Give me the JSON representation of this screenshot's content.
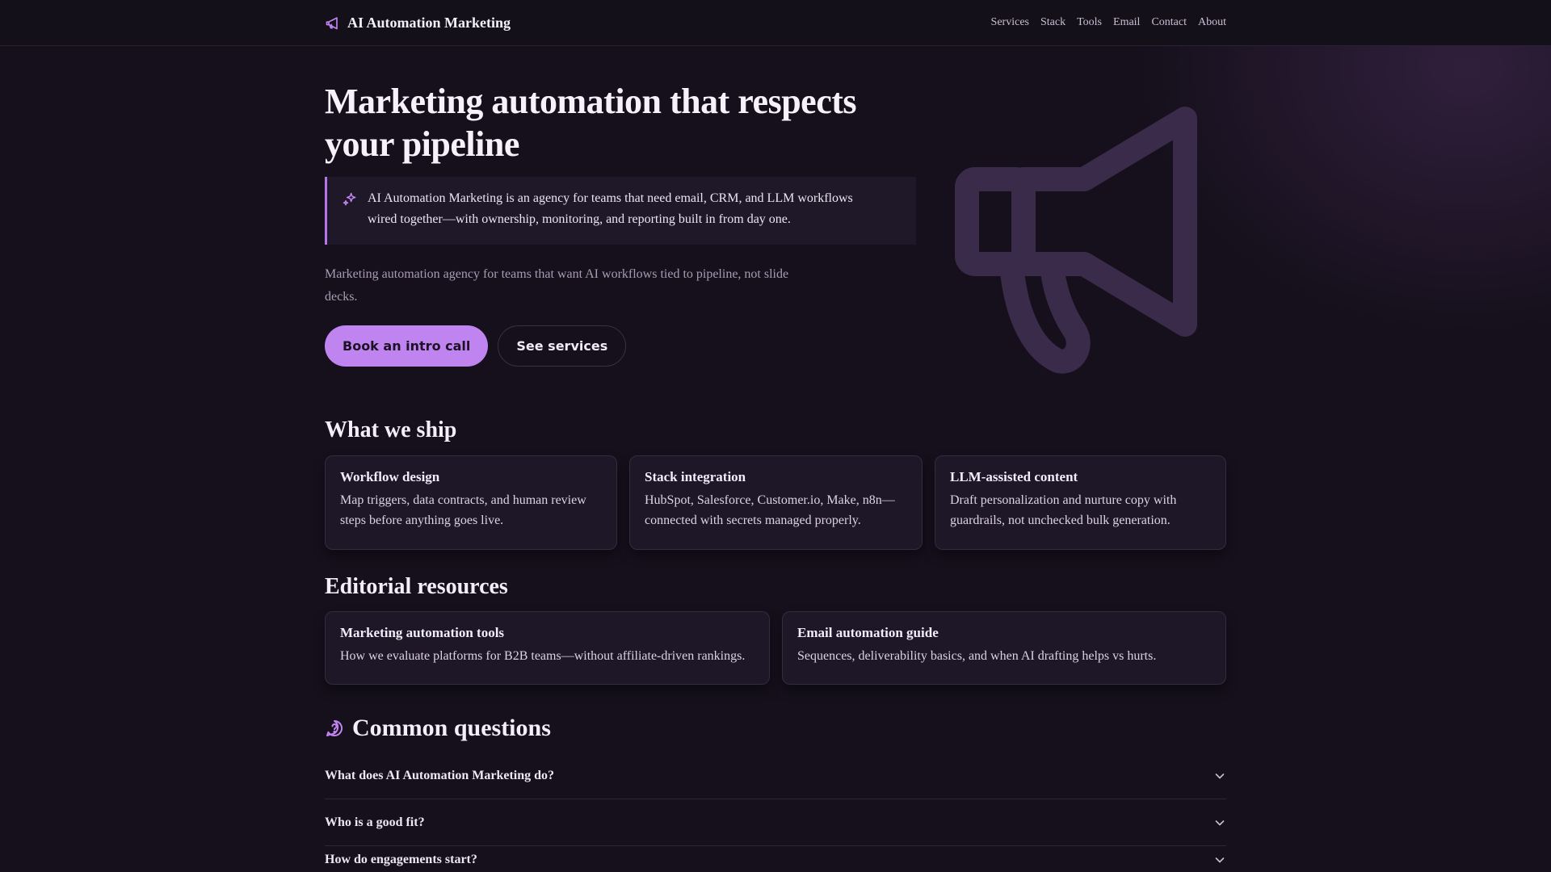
{
  "brand": {
    "name": "AI Automation Marketing",
    "icon": "megaphone-icon"
  },
  "nav": {
    "links": [
      "Services",
      "Stack",
      "Tools",
      "Email",
      "Contact",
      "About"
    ]
  },
  "hero": {
    "title": "Marketing automation that respects your pipeline",
    "callout": "AI Automation Marketing is an agency for teams that need email, CRM, and LLM workflows wired together—with ownership, monitoring, and reporting built in from day one.",
    "callout_icon": "sparkles-icon",
    "subtitle": "Marketing automation agency for teams that want AI workflows tied to pipeline, not slide decks.",
    "primary_cta": "Book an intro call",
    "secondary_cta": "See services",
    "art_icon": "megaphone-icon"
  },
  "ship": {
    "title": "What we ship",
    "cards": [
      {
        "title": "Workflow design",
        "body": "Map triggers, data contracts, and human review steps before anything goes live."
      },
      {
        "title": "Stack integration",
        "body": "HubSpot, Salesforce, Customer.io, Make, n8n—connected with secrets managed properly."
      },
      {
        "title": "LLM-assisted content",
        "body": "Draft personalization and nurture copy with guardrails, not unchecked bulk generation."
      }
    ]
  },
  "resources": {
    "title": "Editorial resources",
    "cards": [
      {
        "title": "Marketing automation tools",
        "body": "How we evaluate platforms for B2B teams—without affiliate-driven rankings."
      },
      {
        "title": "Email automation guide",
        "body": "Sequences, deliverability basics, and when AI drafting helps vs hurts."
      }
    ]
  },
  "faq": {
    "title": "Common questions",
    "icon": "question-bubble-icon",
    "items": [
      "What does AI Automation Marketing do?",
      "Who is a good fit?",
      "How do engagements start?"
    ]
  },
  "colors": {
    "accent": "#c084f0",
    "background": "#15101c",
    "card": "#1d1727"
  }
}
